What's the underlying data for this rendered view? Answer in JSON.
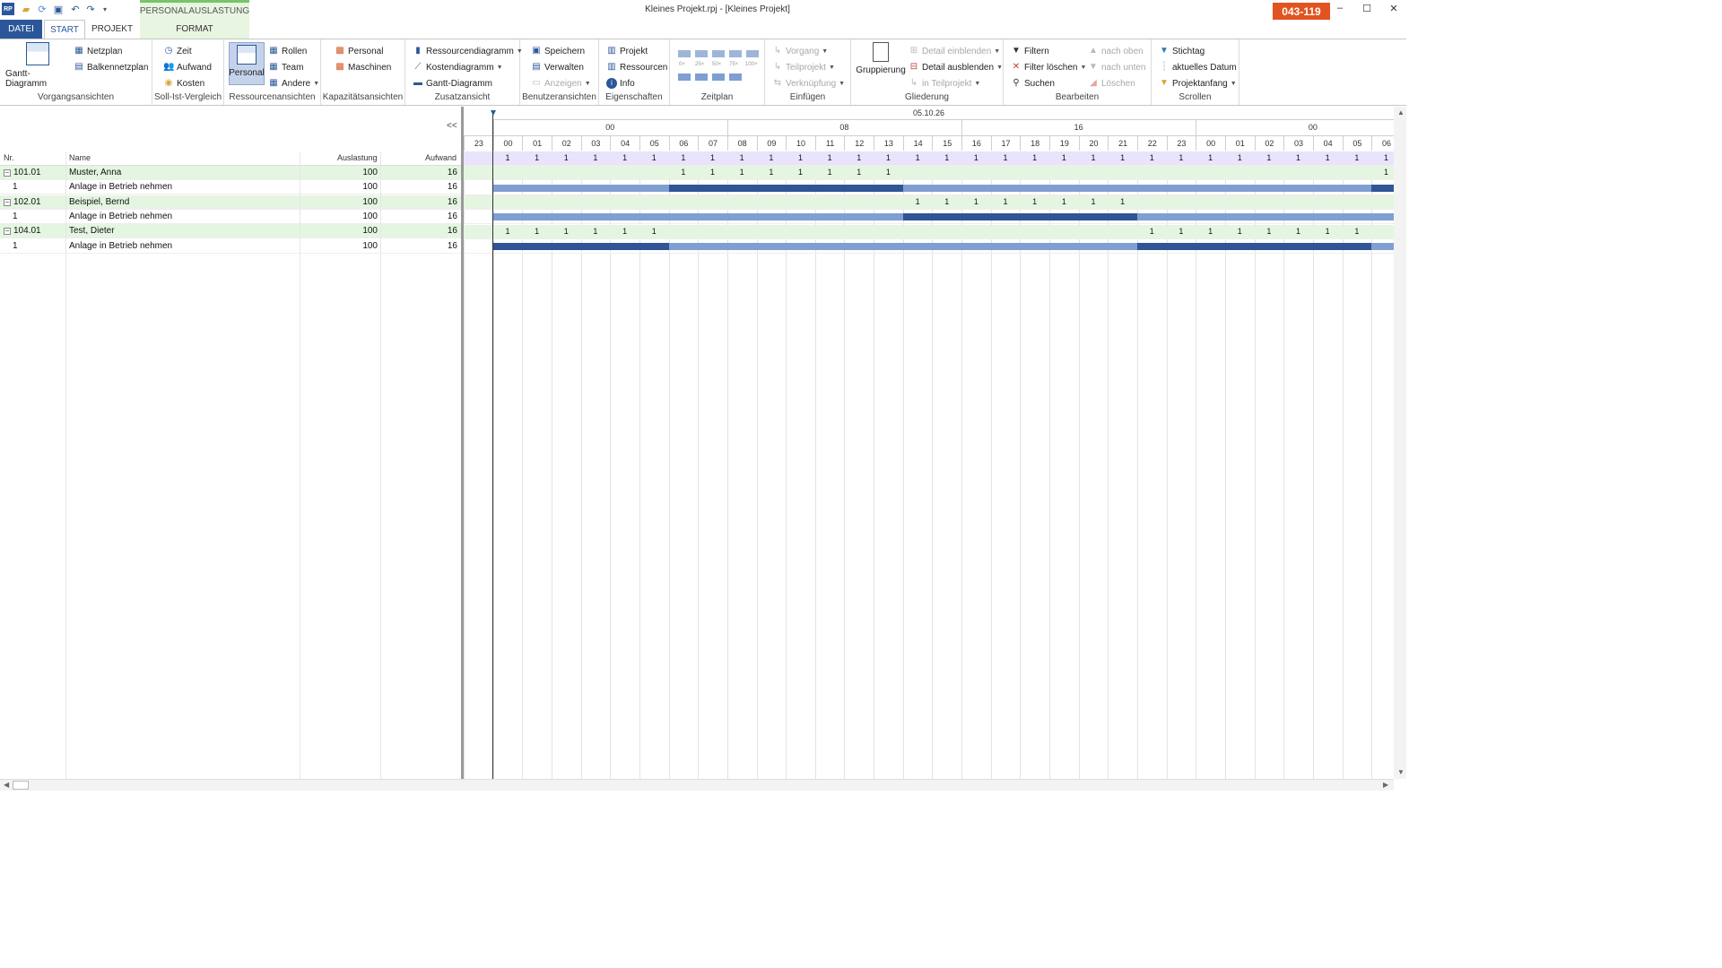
{
  "window": {
    "title": "Kleines Projekt.rpj - [Kleines Projekt]",
    "license_badge": "043-119",
    "context_tab_header": "PERSONALAUSLASTUNG",
    "controls": {
      "minimize": "–",
      "maximize": "☐",
      "close": "✕"
    },
    "quick_access": {
      "logo": "RP"
    }
  },
  "tabs": {
    "datei": "DATEI",
    "start": "START",
    "projekt": "PROJEKT",
    "format": "FORMAT"
  },
  "ribbon": {
    "vorgangsansichten": {
      "label": "Vorgangsansichten",
      "gantt": "Gantt-Diagramm",
      "netzplan": "Netzplan",
      "balkennetzplan": "Balkennetzplan"
    },
    "soll_ist": {
      "label": "Soll-Ist-Vergleich",
      "zeit": "Zeit",
      "aufwand": "Aufwand",
      "kosten": "Kosten"
    },
    "ressourcenansichten": {
      "label": "Ressourcenansichten",
      "personal": "Personal",
      "rollen": "Rollen",
      "team": "Team",
      "andere": "Andere"
    },
    "kapazitaet": {
      "label": "Kapazitätsansichten",
      "personal": "Personal",
      "maschinen": "Maschinen"
    },
    "zusatzansicht": {
      "label": "Zusatzansicht",
      "ressourcendiagramm": "Ressourcendiagramm",
      "kostendiagramm": "Kostendiagramm",
      "gantt": "Gantt-Diagramm"
    },
    "benutzeransichten": {
      "label": "Benutzeransichten",
      "speichern": "Speichern",
      "verwalten": "Verwalten",
      "anzeigen": "Anzeigen"
    },
    "eigenschaften": {
      "label": "Eigenschaften",
      "projekt": "Projekt",
      "ressourcen": "Ressourcen",
      "info": "Info"
    },
    "zeitplan": {
      "label": "Zeitplan",
      "zoom_labels": [
        "0×",
        "25×",
        "50×",
        "75×",
        "100×"
      ]
    },
    "einfuegen": {
      "label": "Einfügen",
      "vorgang": "Vorgang",
      "teilprojekt": "Teilprojekt",
      "verknuepfung": "Verknüpfung"
    },
    "gliederung": {
      "label": "Gliederung",
      "gruppierung": "Gruppierung",
      "detail_einblenden": "Detail einblenden",
      "detail_ausblenden": "Detail ausblenden",
      "in_teilprojekt": "in Teilprojekt"
    },
    "bearbeiten": {
      "label": "Bearbeiten",
      "filtern": "Filtern",
      "filter_loeschen": "Filter löschen",
      "suchen": "Suchen",
      "nach_oben": "nach oben",
      "nach_unten": "nach unten",
      "loeschen": "Löschen"
    },
    "scrollen": {
      "label": "Scrollen",
      "stichtag": "Stichtag",
      "aktuelles_datum": "aktuelles Datum",
      "projektanfang": "Projektanfang"
    }
  },
  "grid": {
    "collapse_label": "<<",
    "headers": {
      "nr": "Nr.",
      "name": "Name",
      "auslastung": "Auslastung",
      "aufwand": "Aufwand"
    },
    "rows": [
      {
        "type": "resource",
        "nr": "101.01",
        "name": "Muster, Anna",
        "auslastung": "100",
        "aufwand": "16",
        "toggle": "−"
      },
      {
        "type": "task",
        "nr": "1",
        "name": "Anlage in Betrieb nehmen",
        "auslastung": "100",
        "aufwand": "16"
      },
      {
        "type": "resource",
        "nr": "102.01",
        "name": "Beispiel, Bernd",
        "auslastung": "100",
        "aufwand": "16",
        "toggle": "−"
      },
      {
        "type": "task",
        "nr": "1",
        "name": "Anlage in Betrieb nehmen",
        "auslastung": "100",
        "aufwand": "16"
      },
      {
        "type": "resource",
        "nr": "104.01",
        "name": "Test, Dieter",
        "auslastung": "100",
        "aufwand": "16",
        "toggle": "−"
      },
      {
        "type": "task",
        "nr": "1",
        "name": "Anlage in Betrieb nehmen",
        "auslastung": "100",
        "aufwand": "16"
      }
    ]
  },
  "timeline": {
    "date": "05.10.26",
    "mid_labels": [
      "00",
      "08",
      "16",
      "00"
    ],
    "hours": [
      "23",
      "00",
      "01",
      "02",
      "03",
      "04",
      "05",
      "06",
      "07",
      "08",
      "09",
      "10",
      "11",
      "12",
      "13",
      "14",
      "15",
      "16",
      "17",
      "18",
      "19",
      "20",
      "21",
      "22",
      "23",
      "00",
      "01",
      "02",
      "03",
      "04",
      "05",
      "06"
    ],
    "total_row": [
      "",
      "1",
      "1",
      "1",
      "1",
      "1",
      "1",
      "1",
      "1",
      "1",
      "1",
      "1",
      "1",
      "1",
      "1",
      "1",
      "1",
      "1",
      "1",
      "1",
      "1",
      "1",
      "1",
      "1",
      "1",
      "1",
      "1",
      "1",
      "1",
      "1",
      "1",
      "1"
    ],
    "resource_rows": [
      {
        "values": [
          "",
          "",
          "",
          "",
          "",
          "",
          "",
          "1",
          "1",
          "1",
          "1",
          "1",
          "1",
          "1",
          "1",
          "",
          "",
          "",
          "",
          "",
          "",
          "",
          "",
          "",
          "",
          "",
          "",
          "",
          "",
          "",
          "",
          "1"
        ],
        "bar_segments": [
          {
            "from": 1,
            "to": 7,
            "tone": "light"
          },
          {
            "from": 7,
            "to": 15,
            "tone": "dark"
          },
          {
            "from": 15,
            "to": 31,
            "tone": "light"
          },
          {
            "from": 31,
            "to": 32,
            "tone": "dark"
          }
        ]
      },
      {
        "values": [
          "",
          "",
          "",
          "",
          "",
          "",
          "",
          "",
          "",
          "",
          "",
          "",
          "",
          "",
          "",
          "1",
          "1",
          "1",
          "1",
          "1",
          "1",
          "1",
          "1",
          "",
          "",
          "",
          "",
          "",
          "",
          "",
          "",
          ""
        ],
        "bar_segments": [
          {
            "from": 1,
            "to": 15,
            "tone": "light"
          },
          {
            "from": 15,
            "to": 23,
            "tone": "dark"
          },
          {
            "from": 23,
            "to": 32,
            "tone": "light"
          }
        ]
      },
      {
        "values": [
          "",
          "1",
          "1",
          "1",
          "1",
          "1",
          "1",
          "",
          "",
          "",
          "",
          "",
          "",
          "",
          "",
          "",
          "",
          "",
          "",
          "",
          "",
          "",
          "",
          "1",
          "1",
          "1",
          "1",
          "1",
          "1",
          "1",
          "1",
          ""
        ],
        "bar_segments": [
          {
            "from": 1,
            "to": 7,
            "tone": "dark"
          },
          {
            "from": 7,
            "to": 23,
            "tone": "light"
          },
          {
            "from": 23,
            "to": 31,
            "tone": "dark"
          },
          {
            "from": 31,
            "to": 32,
            "tone": "light"
          }
        ]
      }
    ],
    "colors": {
      "bar_dark": "#2f5597",
      "bar_light": "#7f9fd1",
      "total_bg": "#e9e3fb",
      "resource_bg": "#e4f6e1"
    }
  }
}
